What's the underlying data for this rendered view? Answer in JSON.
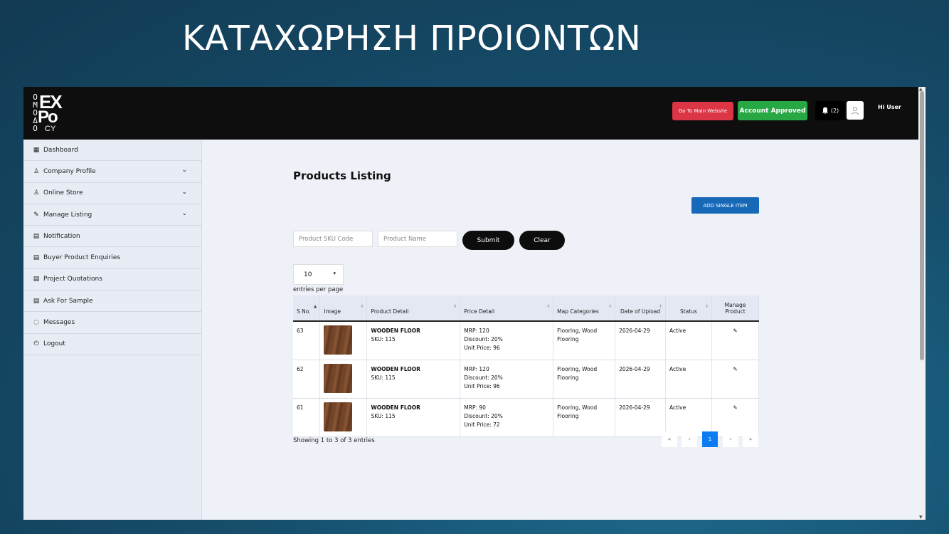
{
  "slide_title": "ΚΑΤΑΧΩΡΗΣΗ ΠΡΟΙΟΝΤΩΝ",
  "header": {
    "logo": {
      "side": "ΟΜΟΔΟ",
      "big1": "EX",
      "big2": "Po",
      "small": "CY"
    },
    "go_main_label": "Go To Main Website",
    "status_label": "Account Approved",
    "notification_count": "(2)",
    "greeting": "Hi User"
  },
  "sidebar": {
    "items": [
      {
        "label": "Dashboard",
        "icon": "grid-icon",
        "glyph": "▦",
        "has_chevron": false
      },
      {
        "label": "Company Profile",
        "icon": "user-icon",
        "glyph": "♙",
        "has_chevron": true
      },
      {
        "label": "Online Store",
        "icon": "user-icon",
        "glyph": "♙",
        "has_chevron": true
      },
      {
        "label": "Manage Listing",
        "icon": "edit-list-icon",
        "glyph": "✎",
        "has_chevron": true
      },
      {
        "label": "Notification",
        "icon": "doc-icon",
        "glyph": "▤",
        "has_chevron": false
      },
      {
        "label": "Buyer Product Enquiries",
        "icon": "doc-icon",
        "glyph": "▤",
        "has_chevron": false
      },
      {
        "label": "Project Quotations",
        "icon": "doc-icon",
        "glyph": "▤",
        "has_chevron": false
      },
      {
        "label": "Ask For Sample",
        "icon": "doc-icon",
        "glyph": "▤",
        "has_chevron": false
      },
      {
        "label": "Messages",
        "icon": "chat-icon",
        "glyph": "◌",
        "has_chevron": false
      },
      {
        "label": "Logout",
        "icon": "power-icon",
        "glyph": "⏻",
        "has_chevron": false
      }
    ]
  },
  "main": {
    "title": "Products Listing",
    "add_button": "ADD SINGLE ITEM",
    "sku_placeholder": "Product SKU Code",
    "name_placeholder": "Product Name",
    "submit_label": "Submit",
    "clear_label": "Clear",
    "per_page_value": "10",
    "entries_label": "entries per page",
    "columns": {
      "sno": "S No.",
      "image": "Image",
      "detail": "Product Detail",
      "price": "Price Detail",
      "categories": "Map Categories",
      "date": "Date of Upload",
      "status": "Status",
      "manage": "Manage Product"
    },
    "rows": [
      {
        "sno": "63",
        "name": "WOODEN FLOOR",
        "sku": "SKU: 115",
        "mrp": "MRP: 120",
        "discount": "Discount: 20%",
        "unit": "Unit Price: 96",
        "categories": "Flooring, Wood Flooring",
        "date": "2026-04-29",
        "status": "Active"
      },
      {
        "sno": "62",
        "name": "WOODEN FLOOR",
        "sku": "SKU: 115",
        "mrp": "MRP: 120",
        "discount": "Discount: 20%",
        "unit": "Unit Price: 96",
        "categories": "Flooring, Wood Flooring",
        "date": "2026-04-29",
        "status": "Active"
      },
      {
        "sno": "61",
        "name": "WOODEN FLOOR",
        "sku": "SKU: 115",
        "mrp": "MRP: 90",
        "discount": "Discount: 20%",
        "unit": "Unit Price: 72",
        "categories": "Flooring, Wood Flooring",
        "date": "2026-04-29",
        "status": "Active"
      }
    ],
    "showing": "Showing 1 to 3 of 3 entries",
    "pagination": {
      "first": "«",
      "prev": "‹",
      "current": "1",
      "next": "›",
      "last": "»"
    }
  }
}
